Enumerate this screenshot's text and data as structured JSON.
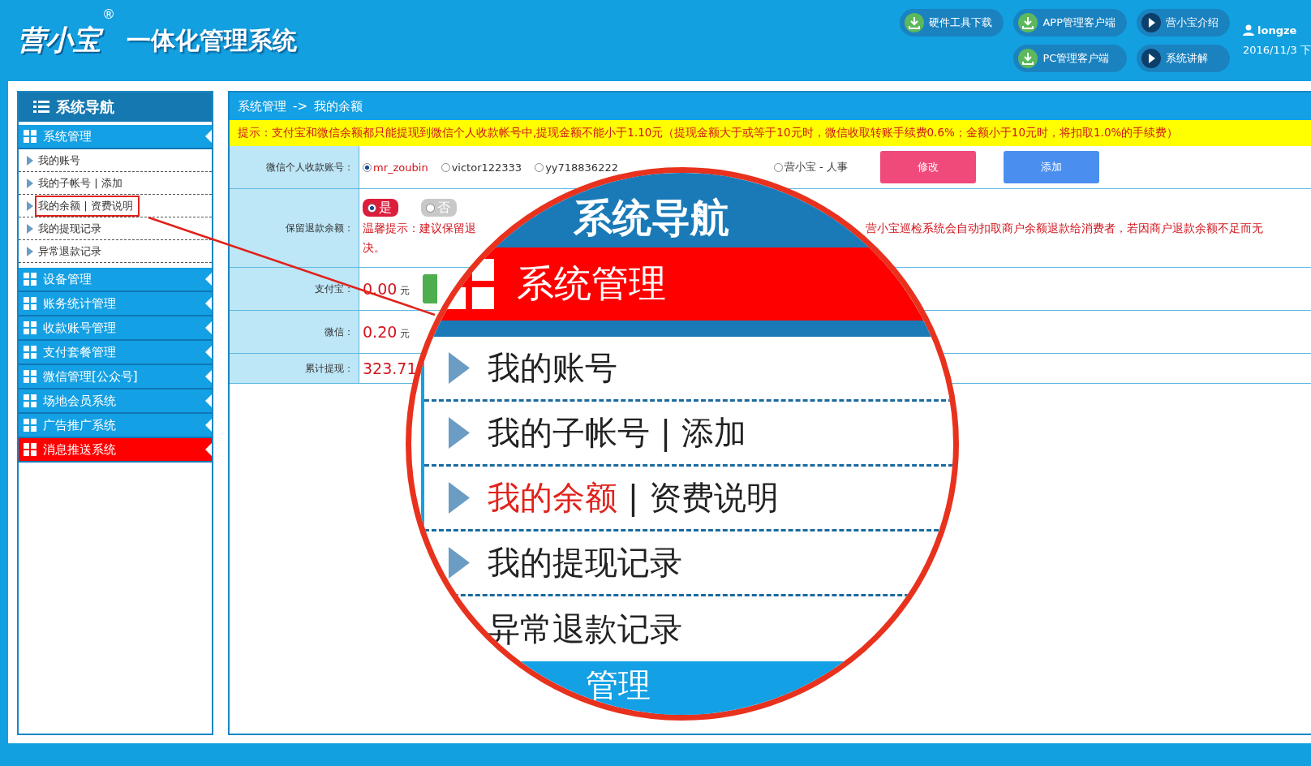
{
  "header": {
    "logo": "营小宝",
    "registered": "®",
    "title": "一体化管理系统",
    "buttons": [
      {
        "label": "硬件工具下载",
        "kind": "download"
      },
      {
        "label": "APP管理客户端",
        "kind": "download"
      },
      {
        "label": "营小宝介绍",
        "kind": "play"
      },
      {
        "label": "PC管理客户端",
        "kind": "download"
      },
      {
        "label": "系统讲解",
        "kind": "play"
      }
    ],
    "user": "longze",
    "date": "2016/11/3 下"
  },
  "sidebar": {
    "title": "系统导航",
    "sections": [
      {
        "label": "系统管理",
        "selected": false,
        "expanded": true,
        "children": [
          {
            "label": "我的账号",
            "selected": false
          },
          {
            "label": "我的子帐号",
            "sep": "|",
            "link": "添加",
            "selected": false
          },
          {
            "label": "我的余额",
            "sep": "|",
            "link": "资费说明",
            "selected": true
          },
          {
            "label": "我的提现记录",
            "selected": false
          },
          {
            "label": "异常退款记录",
            "selected": false
          }
        ]
      },
      {
        "label": "设备管理",
        "selected": false
      },
      {
        "label": "账务统计管理",
        "selected": false
      },
      {
        "label": "收款账号管理",
        "selected": false
      },
      {
        "label": "支付套餐管理",
        "selected": false
      },
      {
        "label": "微信管理[公众号]",
        "selected": false
      },
      {
        "label": "场地会员系统",
        "selected": false
      },
      {
        "label": "广告推广系统",
        "selected": false
      },
      {
        "label": "消息推送系统",
        "selected": true
      }
    ]
  },
  "breadcrumb": {
    "path": "系统管理",
    "separator": "->",
    "current": "我的余额"
  },
  "notice": "提示：支付宝和微信余额都只能提现到微信个人收款帐号中,提现金额不能小于1.10元（提现金额大于或等于10元时，微信收取转账手续费0.6%；金额小于10元时，将扣取1.0%的手续费）",
  "rows": [
    {
      "kind": "radios",
      "label": "微信个人收款账号：",
      "options": [
        {
          "label": "mr_zoubin",
          "selected": true
        },
        {
          "label": "victor122333",
          "selected": false
        },
        {
          "label": "yy718836222",
          "selected": false
        },
        {
          "label": "营小宝 - 人事",
          "selected": false
        }
      ],
      "buttons": [
        {
          "label": "修改",
          "kind": "edit"
        },
        {
          "label": "添加",
          "kind": "add"
        }
      ]
    },
    {
      "kind": "toggle",
      "label": "保留退款余额：",
      "options": [
        {
          "label": "是",
          "selected": true
        },
        {
          "label": "否",
          "selected": false
        }
      ],
      "tip_parts": [
        "温馨提示：建议保留退",
        "营小宝巡检系统会自动扣取商户余额退款给消费者，若因商户退款余额不足而无"
      ],
      "tip_end": "决。"
    },
    {
      "kind": "amount_action",
      "label": "支付宝：",
      "value": "0.00",
      "unit": "元"
    },
    {
      "kind": "amount",
      "label": "微信：",
      "value": "0.20",
      "unit": "元"
    },
    {
      "kind": "amount",
      "label": "累计提现：",
      "value": "323.71"
    }
  ],
  "magnifier": {
    "title": "系统导航",
    "section": "系统管理",
    "items": [
      {
        "label": "我的账号",
        "selected": false
      },
      {
        "label": "我的子帐号",
        "sep": "|",
        "link": "添加",
        "selected": false
      },
      {
        "label": "我的余额",
        "sep": "|",
        "link": "资费说明",
        "selected": true
      },
      {
        "label": "我的提现记录",
        "selected": false
      },
      {
        "label": "异常退款记录",
        "selected": false
      }
    ],
    "next_section": "管理"
  }
}
